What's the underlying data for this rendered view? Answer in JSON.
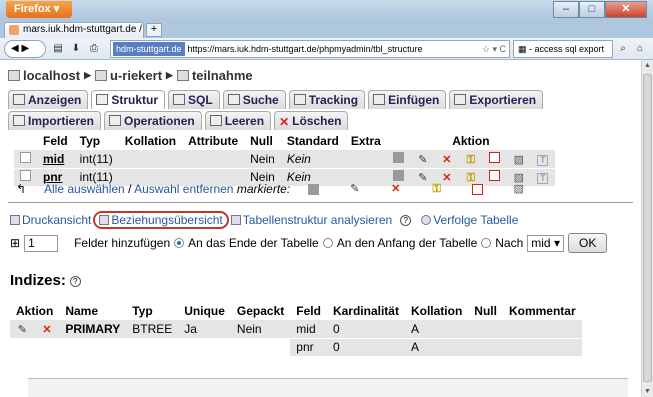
{
  "browser": {
    "app_button": "Firefox",
    "tab_title": "mars.iuk.hdm-stuttgart.de / loca...",
    "new_tab": "+",
    "site_identity": "hdm-stuttgart.de",
    "url": "https://mars.iuk.hdm-stuttgart.de/phpmyadmin/tbl_structure",
    "search_text": "- access sql export",
    "window_controls": [
      "minimize",
      "maximize",
      "close"
    ]
  },
  "breadcrumb": [
    "localhost",
    "u-riekert",
    "teilnahme"
  ],
  "tabs_row1": [
    {
      "label": "Anzeigen",
      "icon": "table-view-icon"
    },
    {
      "label": "Struktur",
      "icon": "structure-icon",
      "active": true
    },
    {
      "label": "SQL",
      "icon": "sql-icon"
    },
    {
      "label": "Suche",
      "icon": "search-icon"
    },
    {
      "label": "Tracking",
      "icon": "eye-icon"
    },
    {
      "label": "Einfügen",
      "icon": "insert-icon"
    },
    {
      "label": "Exportieren",
      "icon": "export-icon"
    }
  ],
  "tabs_row2": [
    {
      "label": "Importieren",
      "icon": "import-icon"
    },
    {
      "label": "Operationen",
      "icon": "wrench-icon"
    },
    {
      "label": "Leeren",
      "icon": "empty-table-icon"
    },
    {
      "label": "Löschen",
      "icon": "delete-icon"
    }
  ],
  "structure": {
    "headers": [
      "Feld",
      "Typ",
      "Kollation",
      "Attribute",
      "Null",
      "Standard",
      "Extra",
      "Aktion"
    ],
    "rows": [
      {
        "feld": "mid",
        "typ": "int(11)",
        "kollation": "",
        "attribute": "",
        "null": "Nein",
        "standard": "Kein",
        "extra": ""
      },
      {
        "feld": "pnr",
        "typ": "int(11)",
        "kollation": "",
        "attribute": "",
        "null": "Nein",
        "standard": "Kein",
        "extra": ""
      }
    ],
    "check_all": "Alle auswählen",
    "separator": "/",
    "uncheck_all": "Auswahl entfernen",
    "marked": "markierte:"
  },
  "links": {
    "print": "Druckansicht",
    "relations": "Beziehungsübersicht",
    "analyze": "Tabellenstruktur analysieren",
    "track": "Verfolge Tabelle"
  },
  "add_fields": {
    "count": "1",
    "label": "Felder hinzufügen",
    "at_end": "An das Ende der Tabelle",
    "at_start": "An den Anfang der Tabelle",
    "after": "Nach",
    "after_select": "mid",
    "ok": "OK"
  },
  "indexes": {
    "title": "Indizes:",
    "headers": [
      "Aktion",
      "Name",
      "Typ",
      "Unique",
      "Gepackt",
      "Feld",
      "Kardinalität",
      "Kollation",
      "Null",
      "Kommentar"
    ],
    "rows": [
      {
        "name": "PRIMARY",
        "typ": "BTREE",
        "unique": "Ja",
        "gepackt": "Nein",
        "feld": "mid",
        "kardinalitaet": "0",
        "kollation": "A",
        "null": "",
        "kommentar": ""
      },
      {
        "name": "",
        "typ": "",
        "unique": "",
        "gepackt": "",
        "feld": "pnr",
        "kardinalitaet": "0",
        "kollation": "A",
        "null": "",
        "kommentar": ""
      }
    ]
  }
}
